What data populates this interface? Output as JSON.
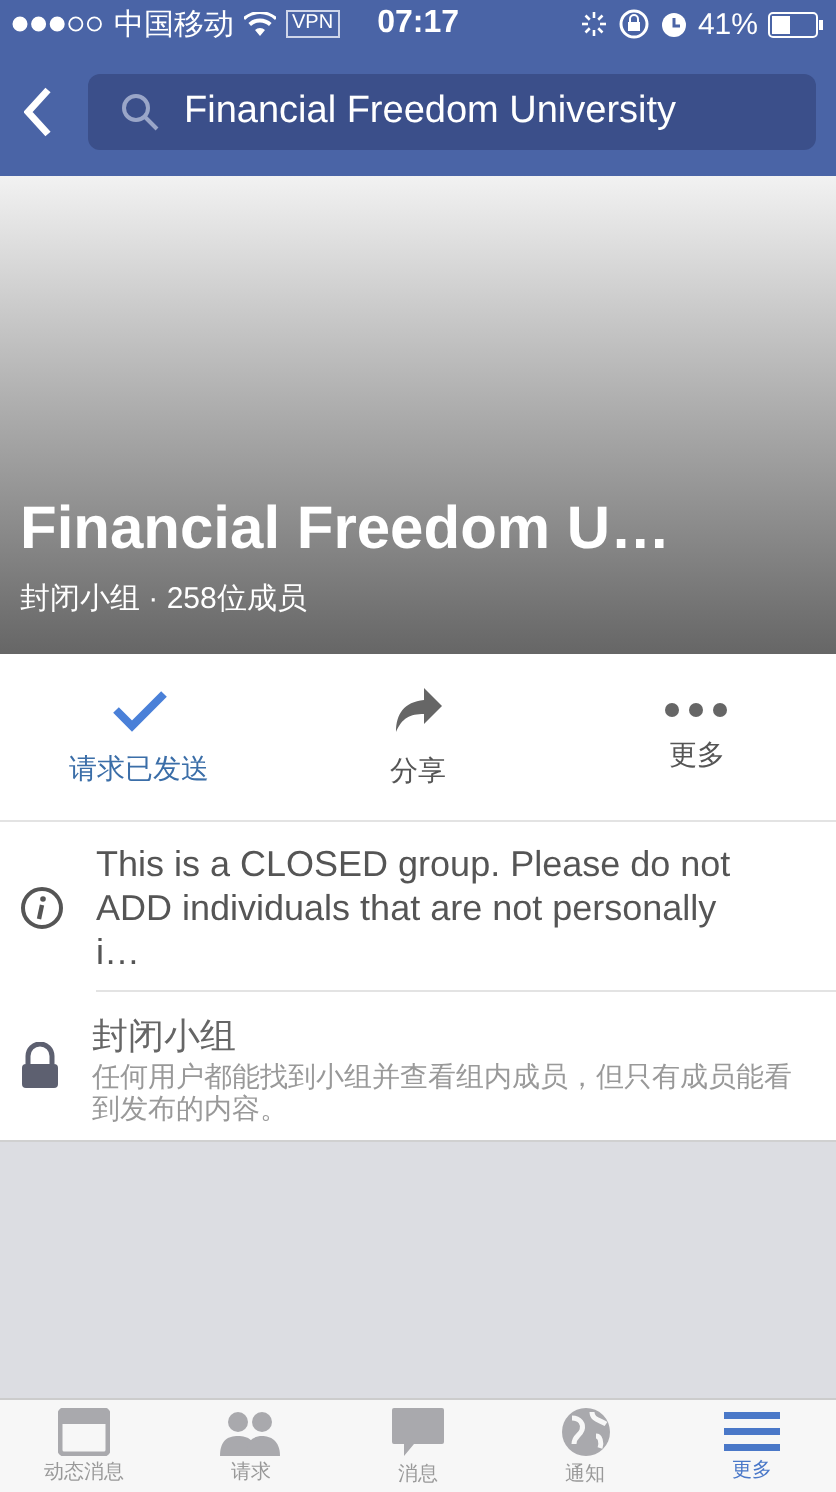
{
  "status_bar": {
    "carrier": "中国移动",
    "vpn": "VPN",
    "time": "07:17",
    "battery": "41%"
  },
  "nav": {
    "search_value": "Financial Freedom University"
  },
  "group": {
    "name": "Financial Freedom U…",
    "meta": "封闭小组 · 258位成员"
  },
  "actions": [
    {
      "kind": "check",
      "label": "请求已发送",
      "active": true
    },
    {
      "kind": "share",
      "label": "分享",
      "active": false
    },
    {
      "kind": "more",
      "label": "更多",
      "active": false
    }
  ],
  "info": [
    {
      "kind": "info",
      "text": "This is a CLOSED group. Please do not ADD individuals that are not personally i…"
    },
    {
      "kind": "lock",
      "title": "封闭小组",
      "text": "任何用户都能找到小组并查看组内成员，但只有成员能看到发布的内容。"
    }
  ],
  "tab_bar": [
    {
      "kind": "feed",
      "label": "动态消息",
      "selected": false
    },
    {
      "kind": "requests",
      "label": "请求",
      "selected": false
    },
    {
      "kind": "messages",
      "label": "消息",
      "selected": false
    },
    {
      "kind": "notifications",
      "label": "通知",
      "selected": false
    },
    {
      "kind": "menu",
      "label": "更多",
      "selected": true
    }
  ]
}
